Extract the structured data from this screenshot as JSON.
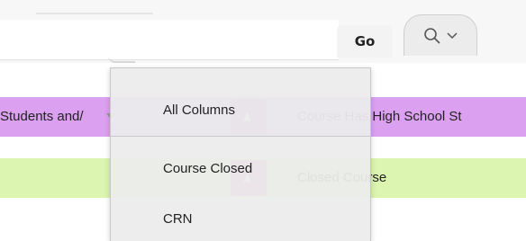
{
  "toolbar": {
    "go_label": "Go",
    "search_icon": "search-icon",
    "dropdown_icon": "chevron-down-icon"
  },
  "table": {
    "rows": [
      {
        "left_text": "Students and/",
        "right_text": "Course Has High School St",
        "row_color": "#dca0f0",
        "swatch_color": "#b06ec8"
      },
      {
        "left_text": "",
        "right_text": "Closed Course",
        "row_color": "#dcf5b0",
        "swatch_color": "#d86aa8"
      }
    ]
  },
  "column_menu": {
    "items": [
      {
        "label": "All Columns"
      },
      {
        "label": "Course Closed"
      },
      {
        "label": "CRN"
      }
    ]
  }
}
